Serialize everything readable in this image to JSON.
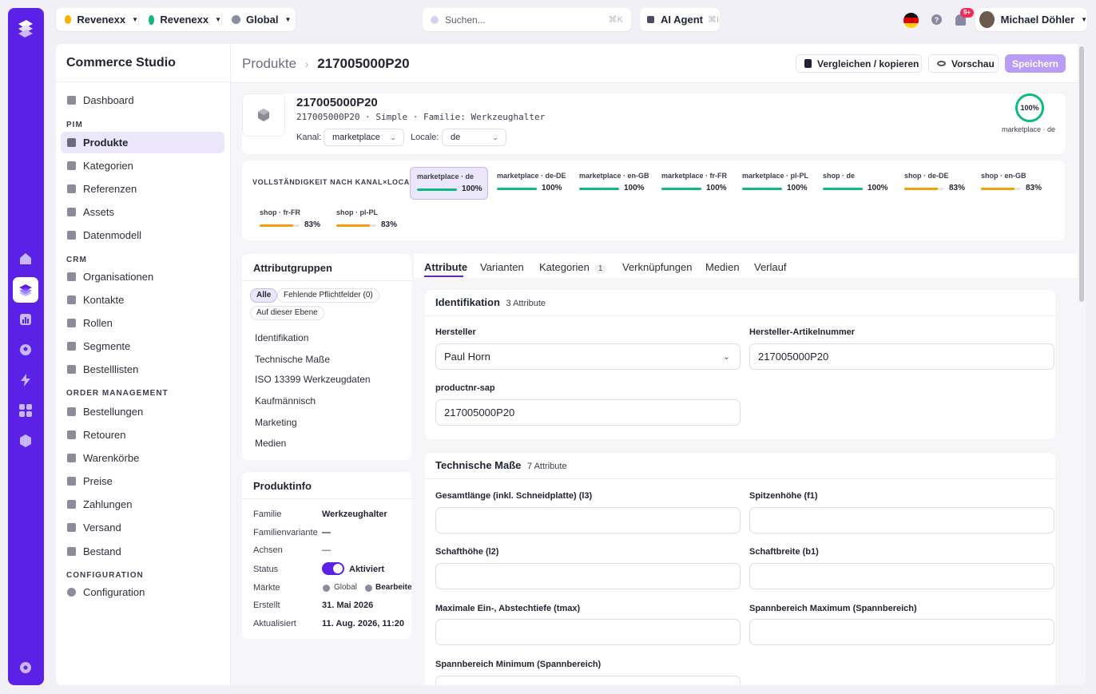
{
  "topbar": {
    "workspace_1": "Revenexx",
    "workspace_2": "Revenexx",
    "region": "Global",
    "search_placeholder": "Suchen...",
    "search_shortcut": "⌘K",
    "ai_agent_label": "AI Agent",
    "ai_agent_shortcut": "⌘I",
    "notifications_badge": "9+",
    "user_name": "Michael Döhler"
  },
  "sidebar": {
    "title": "Commerce Studio",
    "top_item": "Dashboard",
    "sections": [
      {
        "label": "PIM",
        "items": [
          "Produkte",
          "Kategorien",
          "Referenzen",
          "Assets",
          "Datenmodell"
        ]
      },
      {
        "label": "CRM",
        "items": [
          "Organisationen",
          "Kontakte",
          "Rollen",
          "Segmente",
          "Bestelllisten"
        ]
      },
      {
        "label": "ORDER MANAGEMENT",
        "items": [
          "Bestellungen",
          "Retouren",
          "Warenkörbe",
          "Preise",
          "Zahlungen",
          "Versand",
          "Bestand"
        ]
      },
      {
        "label": "CONFIGURATION",
        "items": [
          "Configuration"
        ]
      }
    ],
    "active": "Produkte"
  },
  "header": {
    "breadcrumb_parent": "Produkte",
    "breadcrumb_current": "217005000P20",
    "compare_button": "Vergleichen / kopieren",
    "preview_button": "Vorschau",
    "save_button": "Speichern"
  },
  "product": {
    "sku": "217005000P20",
    "meta": "217005000P20 · Simple · Familie: Werkzeughalter",
    "channel_label": "Kanal:",
    "channel_value": "marketplace",
    "locale_label": "Locale:",
    "locale_value": "de",
    "completeness_pct": "100%",
    "completeness_scope": "marketplace · de"
  },
  "completeness": {
    "title": "VOLLSTÄNDIGKEIT NACH KANAL×LOCALE",
    "entries": [
      {
        "label": "marketplace · de",
        "pct": "100%",
        "value": 100,
        "color": "#10b981"
      },
      {
        "label": "marketplace · de-DE",
        "pct": "100%",
        "value": 100,
        "color": "#10b981"
      },
      {
        "label": "marketplace · en-GB",
        "pct": "100%",
        "value": 100,
        "color": "#10b981"
      },
      {
        "label": "marketplace · fr-FR",
        "pct": "100%",
        "value": 100,
        "color": "#10b981"
      },
      {
        "label": "marketplace · pl-PL",
        "pct": "100%",
        "value": 100,
        "color": "#10b981"
      },
      {
        "label": "shop · de",
        "pct": "100%",
        "value": 100,
        "color": "#10b981"
      },
      {
        "label": "shop · de-DE",
        "pct": "83%",
        "value": 83,
        "color": "#f59e0b"
      },
      {
        "label": "shop · en-GB",
        "pct": "83%",
        "value": 83,
        "color": "#f59e0b"
      },
      {
        "label": "shop · fr-FR",
        "pct": "83%",
        "value": 83,
        "color": "#f59e0b"
      },
      {
        "label": "shop · pl-PL",
        "pct": "83%",
        "value": 83,
        "color": "#f59e0b"
      }
    ]
  },
  "attribute_groups": {
    "title": "Attributgruppen",
    "filters": [
      "Alle",
      "Fehlende Pflichtfelder (0)",
      "Auf dieser Ebene"
    ],
    "groups": [
      "Identifikation",
      "Technische Maße",
      "ISO 13399 Werkzeugdaten",
      "Kaufmännisch",
      "Marketing",
      "Medien"
    ]
  },
  "product_info": {
    "title": "Produktinfo",
    "rows": {
      "familie_label": "Familie",
      "familie": "Werkzeughalter",
      "variante_label": "Familienvariante",
      "variante": "—",
      "achsen_label": "Achsen",
      "achsen": "—",
      "status_label": "Status",
      "status": "Aktiviert",
      "maerkte_label": "Märkte",
      "maerkte": "Global",
      "maerkte_edit": "Bearbeiten",
      "erstellt_label": "Erstellt",
      "erstellt": "31. Mai 2026",
      "aktualisiert_label": "Aktualisiert",
      "aktualisiert": "11. Aug. 2026, 11:20"
    }
  },
  "tabs": [
    {
      "label": "Attribute"
    },
    {
      "label": "Varianten"
    },
    {
      "label": "Kategorien",
      "count": "1"
    },
    {
      "label": "Verknüpfungen"
    },
    {
      "label": "Medien"
    },
    {
      "label": "Verlauf"
    }
  ],
  "identifikation": {
    "title": "Identifikation",
    "count": "3 Attribute",
    "hersteller_label": "Hersteller",
    "hersteller_value": "Paul Horn",
    "artnr_label": "Hersteller-Artikelnummer",
    "artnr_value": "217005000P20",
    "sap_label": "productnr-sap",
    "sap_value": "217005000P20"
  },
  "technische_masse": {
    "title": "Technische Maße",
    "count": "7 Attribute",
    "f1": "Gesamtlänge (inkl. Schneidplatte) (l3)",
    "f2": "Spitzenhöhe (f1)",
    "f3": "Schafthöhe (l2)",
    "f4": "Schaftbreite (b1)",
    "f5": "Maximale Ein-, Abstechtiefe (tmax)",
    "f6": "Spannbereich Maximum (Spannbereich)",
    "f7": "Spannbereich Minimum (Spannbereich)"
  }
}
